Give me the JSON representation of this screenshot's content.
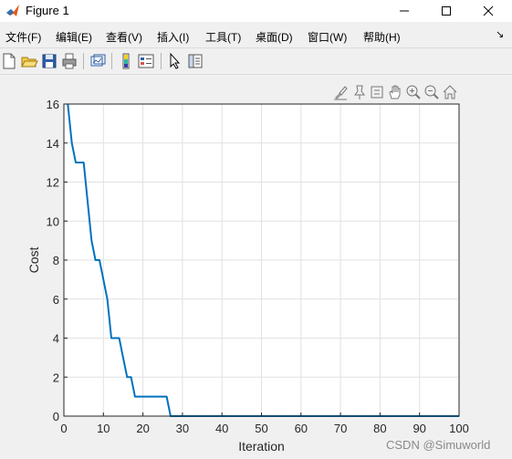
{
  "window": {
    "title": "Figure 1"
  },
  "menu": {
    "items": [
      "文件(F)",
      "编辑(E)",
      "查看(V)",
      "插入(I)",
      "工具(T)",
      "桌面(D)",
      "窗口(W)",
      "帮助(H)"
    ]
  },
  "toolbar": {
    "buttons": [
      "new-figure-icon",
      "open-file-icon",
      "save-icon",
      "print-icon",
      "link-plot-icon",
      "colorbar-icon",
      "legend-icon",
      "edit-plot-icon",
      "property-inspector-icon"
    ]
  },
  "axes_toolbar": {
    "buttons": [
      "brush-icon",
      "data-tips-icon",
      "rotate-icon",
      "pan-icon",
      "zoom-in-icon",
      "zoom-out-icon",
      "home-icon"
    ]
  },
  "watermark": "CSDN @Simuworld",
  "colors": {
    "line": "#0072bd",
    "grid": "#e1e1e1",
    "axes_bg": "#ffffff"
  },
  "chart_data": {
    "type": "line",
    "title": "",
    "xlabel": "Iteration",
    "ylabel": "Cost",
    "xlim": [
      0,
      100
    ],
    "ylim": [
      0,
      16
    ],
    "xticks": [
      0,
      10,
      20,
      30,
      40,
      50,
      60,
      70,
      80,
      90,
      100
    ],
    "yticks": [
      0,
      2,
      4,
      6,
      8,
      10,
      12,
      14,
      16
    ],
    "grid": true,
    "series": [
      {
        "x": [
          1,
          2,
          3,
          4,
          5,
          6,
          7,
          8,
          9,
          10,
          11,
          12,
          13,
          14,
          15,
          16,
          17,
          18,
          19,
          20,
          21,
          22,
          23,
          24,
          25,
          26,
          27,
          28,
          29,
          30,
          31,
          32,
          33,
          34,
          35,
          36,
          37,
          38,
          39,
          40,
          41,
          42,
          43,
          44,
          45,
          46,
          47,
          48,
          49,
          50,
          51,
          52,
          53,
          54,
          55,
          56,
          57,
          58,
          59,
          60,
          61,
          62,
          63,
          64,
          65,
          66,
          67,
          68,
          69,
          70,
          71,
          72,
          73,
          74,
          75,
          76,
          77,
          78,
          79,
          80,
          81,
          82,
          83,
          84,
          85,
          86,
          87,
          88,
          89,
          90,
          91,
          92,
          93,
          94,
          95,
          96,
          97,
          98,
          99,
          100
        ],
        "y": [
          16,
          14,
          13,
          13,
          13,
          11,
          9,
          8,
          8,
          7,
          6,
          4,
          4,
          4,
          3,
          2,
          2,
          1,
          1,
          1,
          1,
          1,
          1,
          1,
          1,
          1,
          0,
          0,
          0,
          0,
          0,
          0,
          0,
          0,
          0,
          0,
          0,
          0,
          0,
          0,
          0,
          0,
          0,
          0,
          0,
          0,
          0,
          0,
          0,
          0,
          0,
          0,
          0,
          0,
          0,
          0,
          0,
          0,
          0,
          0,
          0,
          0,
          0,
          0,
          0,
          0,
          0,
          0,
          0,
          0,
          0,
          0,
          0,
          0,
          0,
          0,
          0,
          0,
          0,
          0,
          0,
          0,
          0,
          0,
          0,
          0,
          0,
          0,
          0,
          0,
          0,
          0,
          0,
          0,
          0,
          0,
          0,
          0,
          0,
          0
        ]
      }
    ]
  }
}
